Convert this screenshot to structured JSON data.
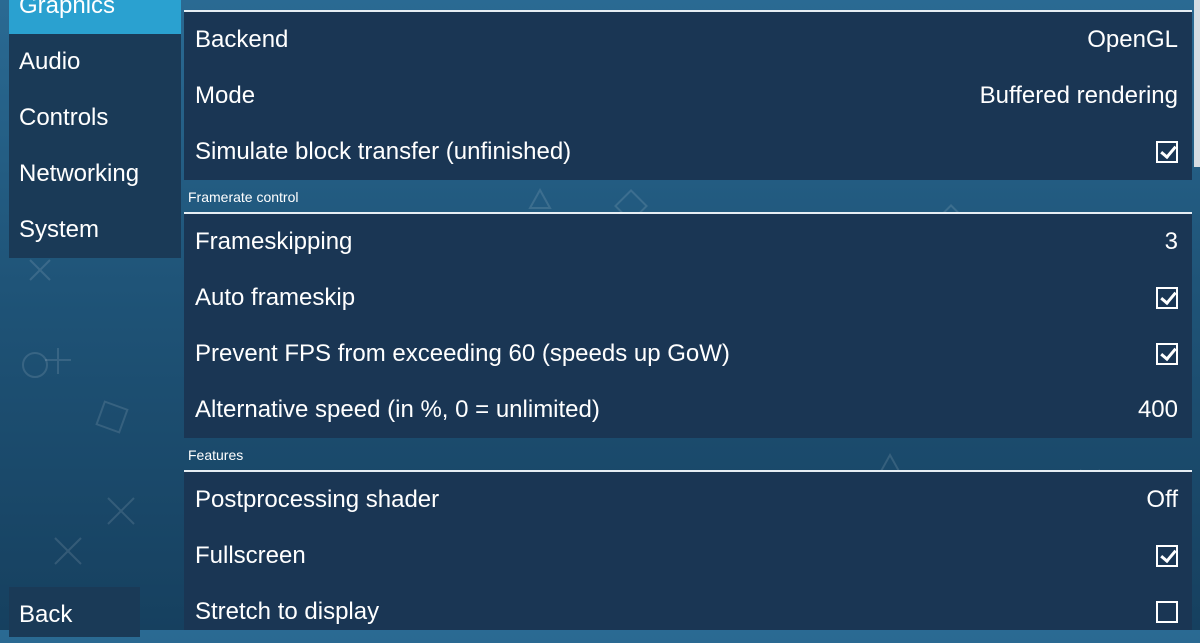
{
  "sidebar": {
    "items": [
      {
        "label": "Graphics",
        "active": true
      },
      {
        "label": "Audio"
      },
      {
        "label": "Controls"
      },
      {
        "label": "Networking"
      },
      {
        "label": "System"
      }
    ],
    "back_label": "Back"
  },
  "sections": {
    "framerate_title": "Framerate control",
    "features_title": "Features"
  },
  "rendering": {
    "backend_label": "Backend",
    "backend_value": "OpenGL",
    "mode_label": "Mode",
    "mode_value": "Buffered rendering",
    "simulate_label": "Simulate block transfer (unfinished)",
    "simulate_checked": true
  },
  "framerate": {
    "frameskip_label": "Frameskipping",
    "frameskip_value": "3",
    "autoframeskip_label": "Auto frameskip",
    "autoframeskip_checked": true,
    "prevent_fps_label": "Prevent FPS from exceeding 60 (speeds up GoW)",
    "prevent_fps_checked": true,
    "altspeed_label": "Alternative speed (in %, 0 = unlimited)",
    "altspeed_value": "400"
  },
  "features": {
    "shader_label": "Postprocessing shader",
    "shader_value": "Off",
    "fullscreen_label": "Fullscreen",
    "fullscreen_checked": true,
    "stretch_label": "Stretch to display",
    "stretch_checked": false
  },
  "colors": {
    "accent": "#2aa1d0",
    "panel": "#1a3654",
    "sidebar": "#1a3a57"
  }
}
